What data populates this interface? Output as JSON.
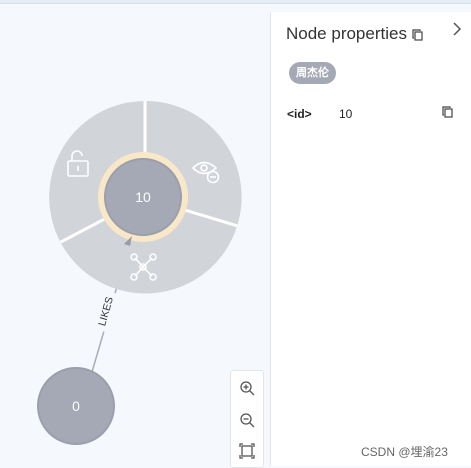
{
  "graph": {
    "selected_node": {
      "caption": "10"
    },
    "other_node": {
      "caption": "0"
    },
    "relationship": {
      "type": "LIKES"
    },
    "ring_actions": {
      "unlock": "unlock-icon",
      "hide": "eye-hide-icon",
      "expand": "expand-graph-icon"
    }
  },
  "panel": {
    "title": "Node properties",
    "label": "周杰伦",
    "properties": [
      {
        "key": "<id>",
        "value": "10"
      }
    ]
  },
  "zoom_controls": [
    "zoom-in-icon",
    "zoom-out-icon",
    "fit-to-screen-icon"
  ],
  "watermark": "CSDN @埋渝23",
  "colors": {
    "node_fill": "#a5a9b5",
    "node_border": "#9b9fab",
    "ring_segment": "#d1d4d9",
    "selection_halo": "#f8e8c8",
    "background": "#f5f9fd"
  }
}
